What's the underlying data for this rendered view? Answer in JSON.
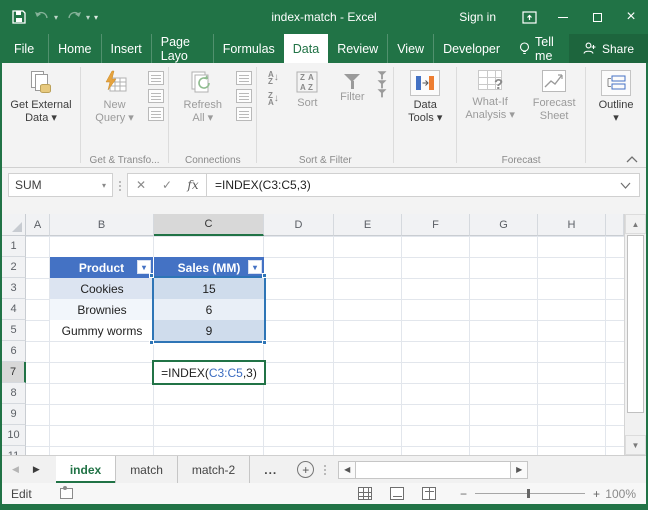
{
  "colors": {
    "excel_green": "#217346",
    "table_header_blue": "#4472c4",
    "selection_blue": "#2e75b6",
    "band_blue": "#d9e1f2"
  },
  "window": {
    "title": "index-match - Excel",
    "sign_in": "Sign in"
  },
  "ribbon": {
    "tabs": [
      "File",
      "Home",
      "Insert",
      "Page Layo",
      "Formulas",
      "Data",
      "Review",
      "View",
      "Developer"
    ],
    "tell_me": "Tell me",
    "share": "Share",
    "get_external": {
      "line1": "Get External",
      "line2": "Data ▾"
    },
    "new_query": {
      "line1": "New",
      "line2": "Query ▾"
    },
    "refresh": {
      "line1": "Refresh",
      "line2": "All ▾"
    },
    "sort": "Sort",
    "filter": "Filter",
    "data_tools": {
      "line1": "Data",
      "line2": "Tools ▾"
    },
    "what_if": {
      "line1": "What-If",
      "line2": "Analysis ▾"
    },
    "forecast_sheet": {
      "line1": "Forecast",
      "line2": "Sheet"
    },
    "outline": "Outline",
    "outline_dd": "▾",
    "group_labels": {
      "transform": "Get & Transfo...",
      "connections": "Connections",
      "sort_filter": "Sort & Filter",
      "forecast": "Forecast"
    },
    "az_up": "A↓Z",
    "za_down": "Z↓A"
  },
  "formula_bar": {
    "name_box": "SUM",
    "cancel": "✕",
    "enter": "✓",
    "fx": "fx",
    "formula": "=INDEX(C3:C5,3)"
  },
  "grid": {
    "columns": [
      "A",
      "B",
      "C",
      "D",
      "E",
      "F",
      "G",
      "H"
    ],
    "rows": [
      "1",
      "2",
      "3",
      "4",
      "5",
      "6",
      "7",
      "8",
      "9",
      "10",
      "11"
    ],
    "selected_column": "C",
    "selected_row": "7"
  },
  "table": {
    "headers": [
      "Product",
      "Sales (MM)"
    ],
    "filter_arrow": "▾",
    "rows": [
      [
        "Cookies",
        "15"
      ],
      [
        "Brownies",
        "6"
      ],
      [
        "Gummy worms",
        "9"
      ]
    ]
  },
  "cell_edit": {
    "prefix": "=INDEX(",
    "range": "C3:C5",
    "suffix": ",3)"
  },
  "sheet_bar": {
    "tabs": [
      "index",
      "match",
      "match-2",
      "..."
    ],
    "active_tab": "index",
    "add_label": "+"
  },
  "status_bar": {
    "mode": "Edit",
    "zoom_level": "100%"
  }
}
